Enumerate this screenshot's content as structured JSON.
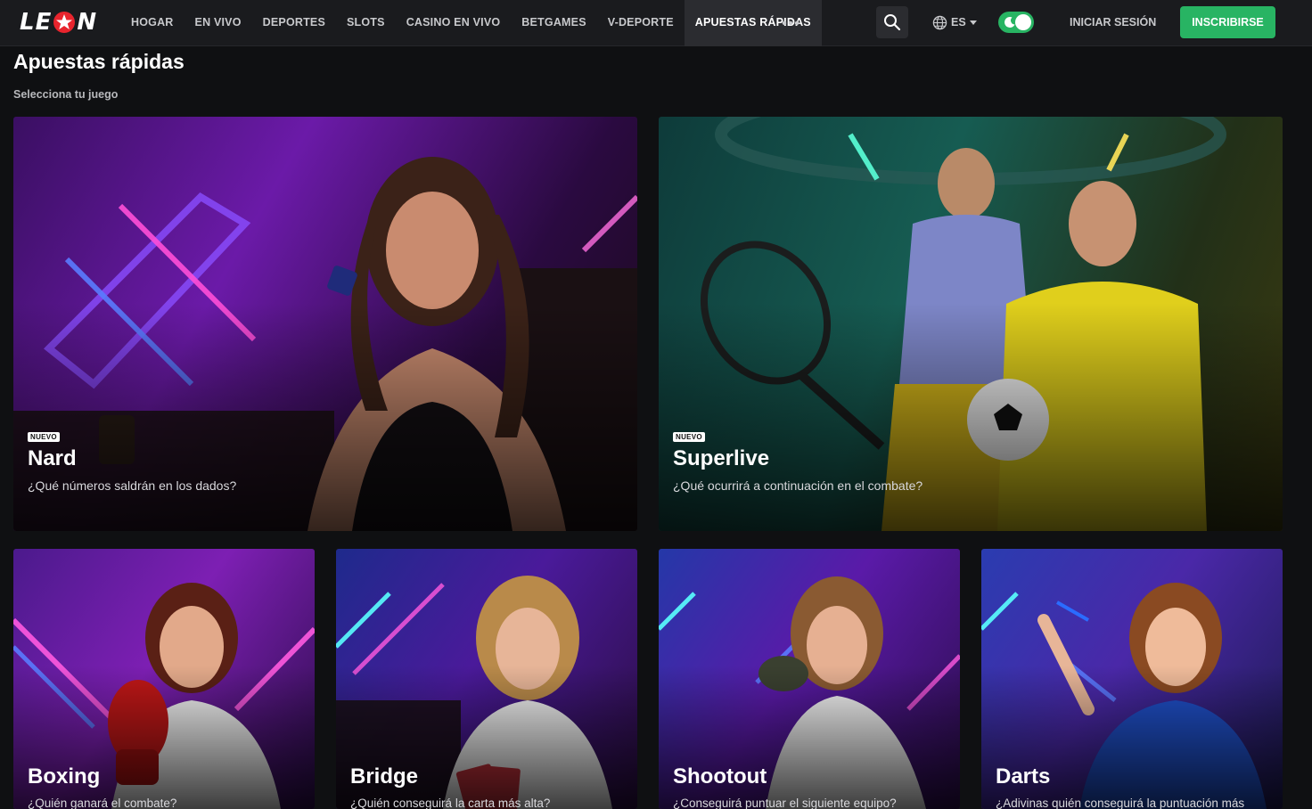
{
  "header": {
    "logo_text": "LEON",
    "nav": [
      {
        "label": "HOGAR"
      },
      {
        "label": "EN VIVO"
      },
      {
        "label": "DEPORTES"
      },
      {
        "label": "SLOTS"
      },
      {
        "label": "CASINO EN VIVO"
      },
      {
        "label": "BETGAMES"
      },
      {
        "label": "V-DEPORTE"
      },
      {
        "label": "APUESTAS RÁPIDAS",
        "active": true
      }
    ],
    "more_icon": "ellipsis-icon",
    "search_icon": "search-icon",
    "language": "ES",
    "theme_toggle_on": true,
    "login_label": "INICIAR SESIÓN",
    "signup_label": "INSCRIBIRSE"
  },
  "page": {
    "title": "Apuestas rápidas",
    "subtitle": "Selecciona tu juego"
  },
  "games": [
    {
      "title": "Nard",
      "badge": "NUEVO",
      "description": "¿Qué números saldrán en los dados?"
    },
    {
      "title": "Superlive",
      "badge": "NUEVO",
      "description": "¿Qué ocurrirá a continuación en el combate?"
    },
    {
      "title": "Boxing",
      "description": "¿Quién ganará el combate?"
    },
    {
      "title": "Bridge",
      "description": "¿Quién conseguirá la carta más alta?"
    },
    {
      "title": "Shootout",
      "description": "¿Conseguirá puntuar el siguiente equipo?"
    },
    {
      "title": "Darts",
      "description": "¿Adivinas quién conseguirá la puntuación más"
    }
  ],
  "colors": {
    "background": "#0f1012",
    "topbar": "#1a1b1e",
    "accent_green": "#28b463",
    "brand_red": "#e8242d"
  }
}
